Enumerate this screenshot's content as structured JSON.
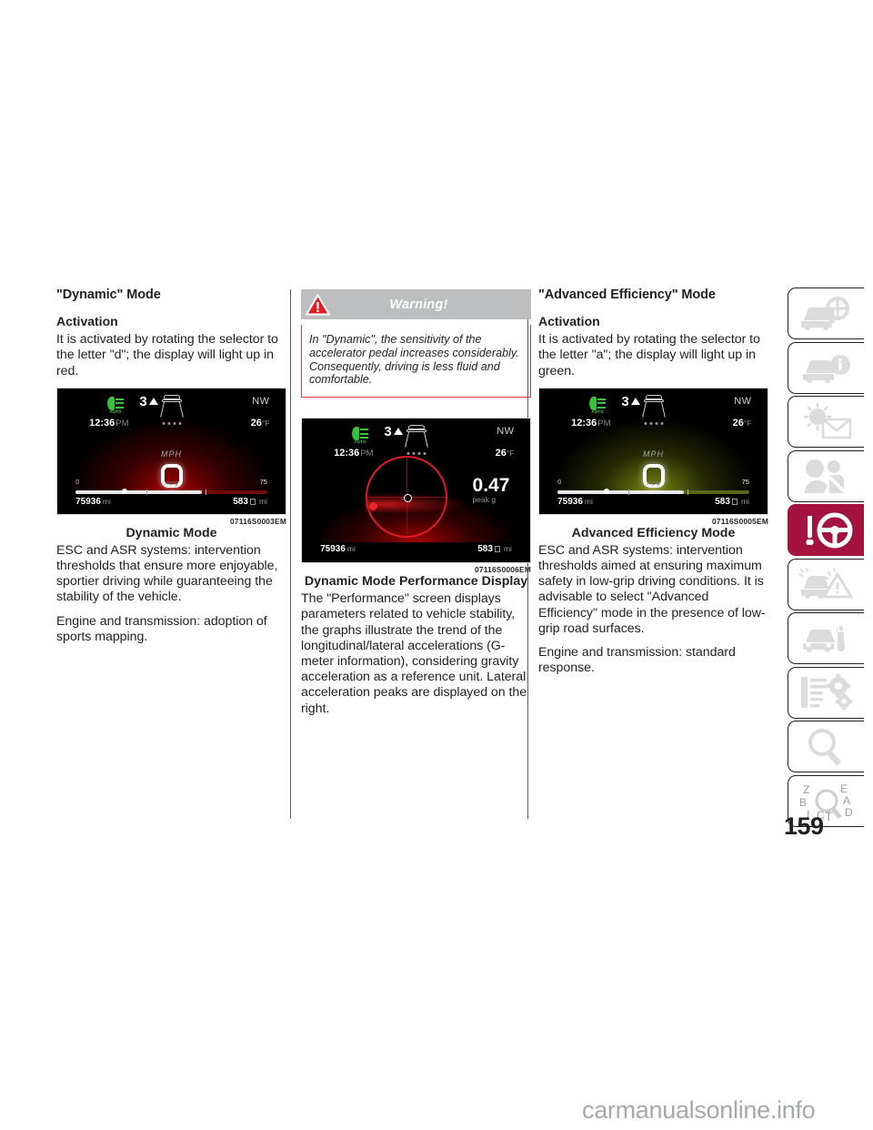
{
  "page": {
    "number": "159",
    "watermark": "carmanualsonline.info"
  },
  "column1": {
    "heading": "\"Dynamic\" Mode",
    "subheading": "Activation",
    "activation_text": "It is activated by rotating the selector to the letter \"d\"; the display will light up in red.",
    "figure": {
      "code": "07116S0003EM",
      "caption": "Dynamic Mode"
    },
    "paragraphs": [
      "ESC and ASR systems: intervention thresholds that ensure more enjoyable, sportier driving while guaranteeing the stability of the vehicle.",
      "Engine and transmission: adoption of sports mapping."
    ],
    "cluster": {
      "headlight_label": "AUTO",
      "gear": "3",
      "clock": "12:36",
      "meridiem": "PM",
      "compass": "NW",
      "temperature": "26",
      "temp_unit": "°F",
      "speed_unit": "MPH",
      "scale_min": "0",
      "scale_max": "75",
      "scale_label": "mpg",
      "odometer": "75936",
      "odometer_unit": "mi",
      "range": "583",
      "range_unit": "mi",
      "accent_color": "#be0000"
    }
  },
  "column2": {
    "warning": {
      "title": "Warning!",
      "text": "In \"Dynamic\", the sensitivity of the accelerator pedal increases considerably. Consequently, driving is less fluid and comfortable."
    },
    "figure": {
      "code": "07116S0006EM",
      "caption": "Dynamic Mode Performance Display"
    },
    "paragraphs": [
      "The \"Performance\" screen displays parameters related to vehicle stability, the graphs illustrate the trend of the longitudinal/lateral accelerations (G-meter information), considering gravity acceleration as a reference unit. Lateral acceleration peaks are displayed on the right."
    ],
    "cluster": {
      "headlight_label": "AUTO",
      "gear": "3",
      "clock": "12:36",
      "meridiem": "PM",
      "compass": "NW",
      "temperature": "26",
      "temp_unit": "°F",
      "peak_value": "0.47",
      "peak_label": "peak g",
      "odometer": "75936",
      "odometer_unit": "mi",
      "range": "583",
      "range_unit": "mi",
      "accent_color": "#e01b22"
    }
  },
  "column3": {
    "heading": "\"Advanced Efficiency\" Mode",
    "subheading": "Activation",
    "activation_text": "It is activated by rotating the selector to the letter \"a\"; the display will light up in green.",
    "figure": {
      "code": "07116S0005EM",
      "caption": "Advanced Efficiency Mode"
    },
    "paragraphs": [
      "ESC and ASR systems: intervention thresholds aimed at ensuring maximum safety in low-grip driving conditions. It is advisable to select \"Advanced Efficiency\" mode in the presence of low-grip road surfaces.",
      "Engine and transmission: standard response."
    ],
    "cluster": {
      "headlight_label": "AUTO",
      "gear": "3",
      "clock": "12:36",
      "meridiem": "PM",
      "compass": "NW",
      "temperature": "26",
      "temp_unit": "°F",
      "speed_unit": "MPH",
      "scale_min": "0",
      "scale_max": "75",
      "scale_label": "mpg",
      "odometer": "75936",
      "odometer_unit": "mi",
      "range": "583",
      "range_unit": "mi",
      "accent_color": "#96a514"
    }
  },
  "tabs": [
    {
      "name": "car-inspection-icon",
      "active": false
    },
    {
      "name": "car-info-icon",
      "active": false
    },
    {
      "name": "climate-mail-icon",
      "active": false
    },
    {
      "name": "airbag-seatbelt-icon",
      "active": false
    },
    {
      "name": "steering-wheel-icon",
      "active": true
    },
    {
      "name": "emergency-hazard-icon",
      "active": false
    },
    {
      "name": "car-maintenance-icon",
      "active": false
    },
    {
      "name": "technical-specifications-icon",
      "active": false
    },
    {
      "name": "search-index-icon",
      "active": false
    },
    {
      "name": "alphabetical-index-icon",
      "active": false
    }
  ],
  "colors": {
    "active_tab": "#a4123f",
    "warning_header": "#bcbec0",
    "warning_border": "#e03a3e"
  }
}
